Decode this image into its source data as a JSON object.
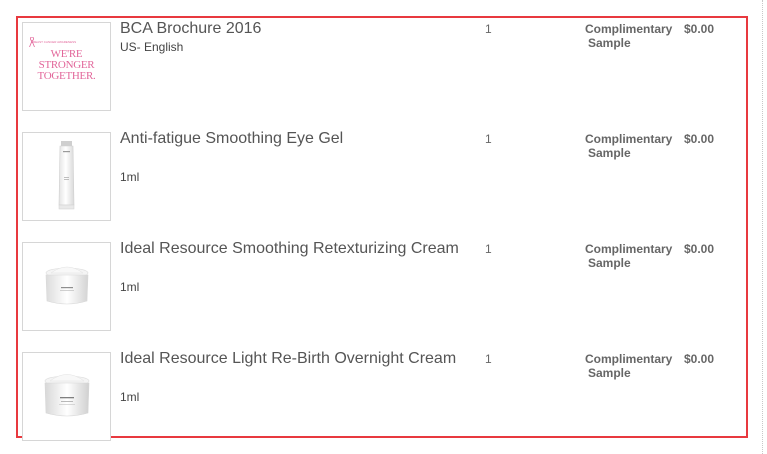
{
  "cart": {
    "items": [
      {
        "name": "BCA Brochure 2016",
        "variant": "US- English",
        "quantity": "1",
        "status_line1": "Complimentary",
        "status_line2": "Sample",
        "price": "$0.00",
        "image": {
          "kind": "brochure",
          "tagline": "WE'RE STRONGER TOGETHER.",
          "accent": "#e2669a"
        }
      },
      {
        "name": "Anti-fatigue Smoothing Eye Gel",
        "variant": "1ml",
        "quantity": "1",
        "status_line1": "Complimentary",
        "status_line2": "Sample",
        "price": "$0.00",
        "image": {
          "kind": "tube"
        }
      },
      {
        "name": "Ideal Resource Smoothing Retexturizing Cream",
        "variant": "1ml",
        "quantity": "1",
        "status_line1": "Complimentary",
        "status_line2": "Sample",
        "price": "$0.00",
        "image": {
          "kind": "jar"
        }
      },
      {
        "name": "Ideal Resource Light Re-Birth Overnight Cream",
        "variant": "1ml",
        "quantity": "1",
        "status_line1": "Complimentary",
        "status_line2": "Sample",
        "price": "$0.00",
        "image": {
          "kind": "jar"
        }
      }
    ]
  },
  "colors": {
    "highlight_border": "#e8393f",
    "text": "#555555",
    "muted_text": "#666666"
  }
}
